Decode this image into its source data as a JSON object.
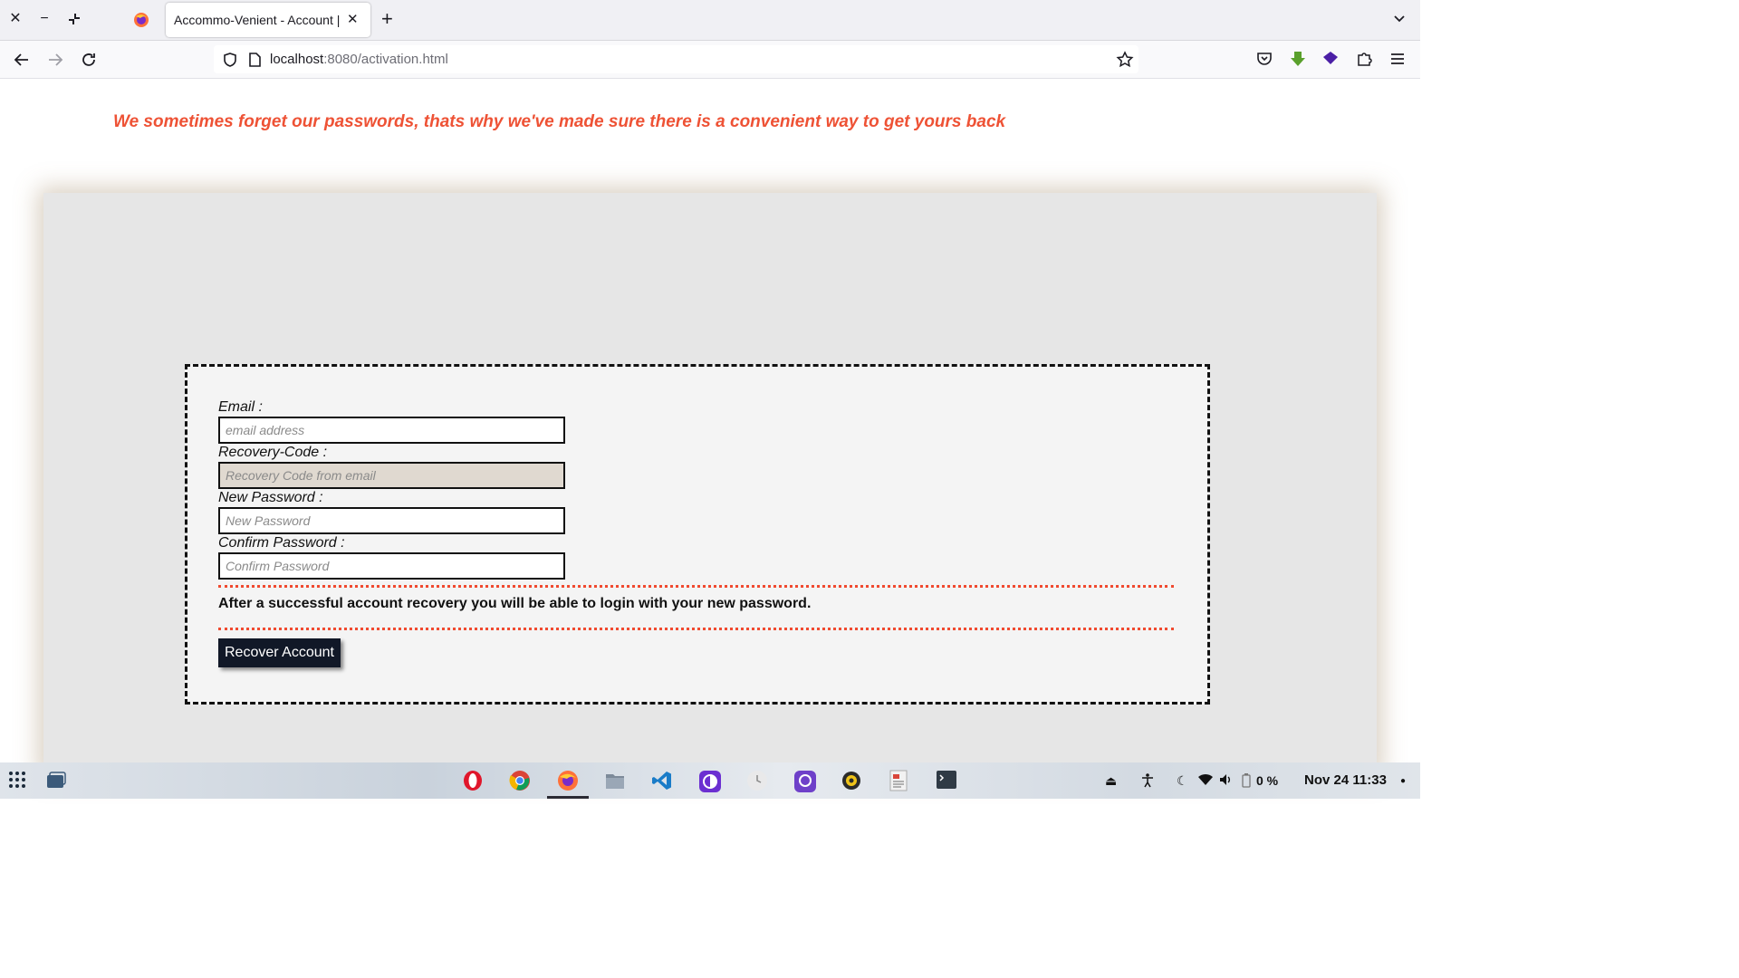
{
  "browser": {
    "tab_title": "Accommo-Venient - Account |",
    "url_host": "localhost",
    "url_rest": ":8080/activation.html"
  },
  "page": {
    "headline": "We sometimes forget our passwords, thats why we've made sure there is a convenient way to get yours back"
  },
  "form": {
    "email_label": "Email  :",
    "email_placeholder": "email address",
    "code_label": "Recovery-Code :",
    "code_placeholder": "Recovery Code from email",
    "new_password_label": "New Password  :",
    "new_password_placeholder": "New Password",
    "confirm_password_label": "Confirm Password  :",
    "confirm_password_placeholder": "Confirm Password",
    "note": "After a successful account recovery you will be able to login with your new password.",
    "submit_label": "Recover Account"
  },
  "taskbar": {
    "apps": [
      "app-grid-icon",
      "window-switcher-icon",
      "opera-icon",
      "chrome-icon",
      "firefox-icon",
      "files-icon",
      "vscode-icon",
      "tor-icon",
      "clock-app-icon",
      "github-icon",
      "rhythmbox-icon",
      "document-viewer-icon",
      "terminal-icon"
    ],
    "battery": "0 %",
    "date": "Nov 24",
    "time": "11:33"
  },
  "colors": {
    "accent": "#ee5235",
    "button_bg": "#111827",
    "panel_bg": "#e6e6e6"
  }
}
